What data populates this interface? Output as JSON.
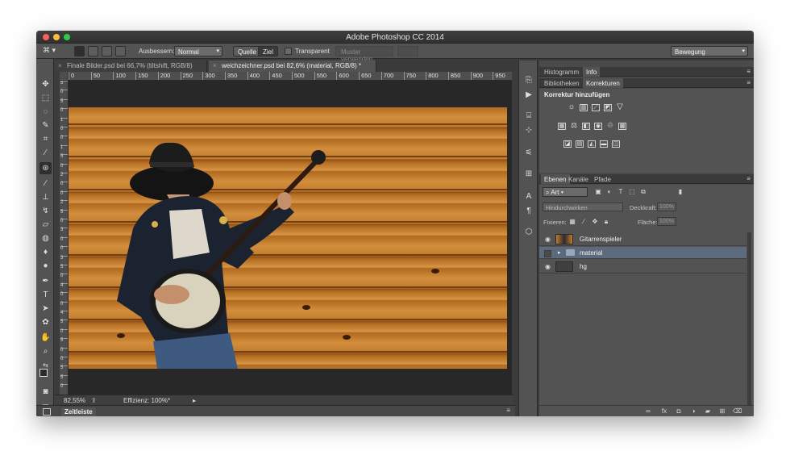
{
  "window": {
    "title": "Adobe Photoshop CC 2014"
  },
  "options_bar": {
    "ausbessern_label": "Ausbessern:",
    "mode_value": "Normal",
    "quelle_label": "Quelle",
    "ziel_label": "Ziel",
    "transparent_label": "Transparent",
    "muster_label": "Muster verwenden",
    "workspace_value": "Bewegung"
  },
  "doc_tabs": [
    {
      "label": "Finale Bilder.psd bei 66,7% (tiltshift, RGB/8)"
    },
    {
      "label": "weichzeichner.psd bei 82,6% (material, RGB/8) *"
    }
  ],
  "ruler": {
    "ticks": [
      "0",
      "50",
      "100",
      "150",
      "200",
      "250",
      "300",
      "350",
      "400",
      "450",
      "500",
      "550",
      "600",
      "650",
      "700",
      "750",
      "800",
      "850",
      "900",
      "950"
    ],
    "vticks": [
      "5",
      "0",
      "5",
      "0",
      "1",
      "0",
      "0",
      "1",
      "5",
      "0",
      "2",
      "0",
      "0",
      "2",
      "5",
      "0",
      "3",
      "0",
      "0",
      "3",
      "5",
      "0",
      "4",
      "0",
      "0",
      "4",
      "5",
      "0",
      "5",
      "0",
      "0",
      "5",
      "5",
      "0"
    ]
  },
  "status": {
    "zoom": "82,55%",
    "efficiency": "Effizienz: 100%*"
  },
  "timeline": {
    "label": "Zeitleiste"
  },
  "panels": {
    "top_tabs": [
      "Histogramm",
      "Info"
    ],
    "adj_tabs": [
      "Bibliotheken",
      "Korrekturen"
    ],
    "adj_title": "Korrektur hinzufügen",
    "layer_tabs": [
      "Ebenen",
      "Kanäle",
      "Pfade"
    ],
    "filter_value": "Art",
    "blend_mode": "Hindurchwirken",
    "opacity_label": "Deckkraft:",
    "opacity_value": "100%",
    "lock_label": "Fixieren:",
    "fill_label": "Fläche:",
    "fill_value": "100%"
  },
  "layers": [
    {
      "name": "Gitarrenspieler",
      "visible": true
    },
    {
      "name": "material",
      "visible": false
    },
    {
      "name": "hg",
      "visible": true
    }
  ],
  "colors": {
    "accent": "#5d6a7e",
    "wood": "#c07a2c"
  }
}
